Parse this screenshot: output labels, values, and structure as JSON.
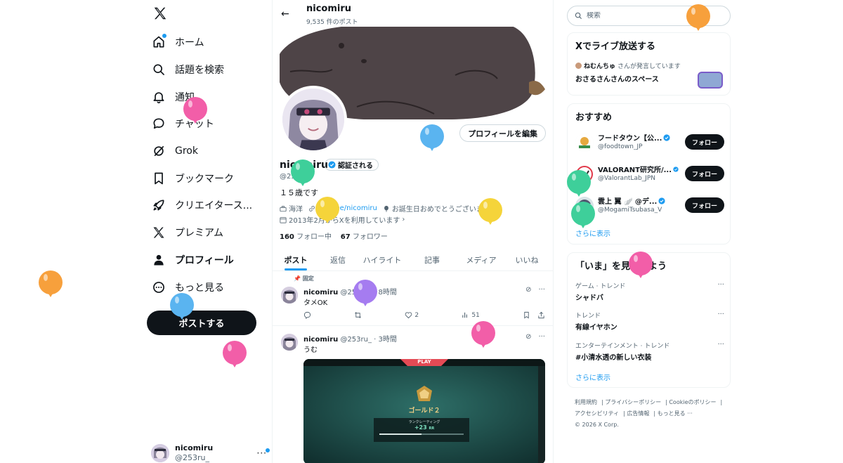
{
  "nav": {
    "home": "ホーム",
    "explore": "話題を検索",
    "notifications": "通知",
    "chat": "チャット",
    "grok": "Grok",
    "bookmarks": "ブックマーク",
    "creator": "クリエイタース...",
    "premium": "プレミアム",
    "profile": "プロフィール",
    "more": "もっと見る",
    "post_button": "ポストする"
  },
  "account": {
    "name": "nicomiru",
    "handle": "@253ru_",
    "more": "···"
  },
  "header": {
    "back": "←",
    "title": "nicomiru",
    "post_count": "9,535 件のポスト"
  },
  "profile": {
    "edit_button": "プロフィールを編集",
    "name": "nicomiru",
    "verified_label": "認証される",
    "handle": "@253ru_",
    "bio": "１５歳です",
    "location": "海洋",
    "link": "linktree/nicomiru",
    "birthday": "お誕生日おめでとうございます。",
    "joined": "2013年2月からXを利用しています",
    "following_count": "160",
    "following_label": "フォロー中",
    "followers_count": "67",
    "followers_label": "フォロワー"
  },
  "tabs": [
    "ポスト",
    "返信",
    "ハイライト",
    "記事",
    "メディア",
    "いいね"
  ],
  "tweets": [
    {
      "pinned_label": "固定",
      "name": "nicomiru",
      "meta": "@253ru_ · 8時間",
      "text": "タメOK",
      "likes": "2",
      "views": "51"
    },
    {
      "name": "nicomiru",
      "meta": "@253ru_ · 3時間",
      "text": "うむ",
      "image": {
        "play": "PLAY",
        "rank": "ゴールド２",
        "rating_label": "ランクレーティング",
        "rating_delta": "+23",
        "rating_unit": "RR"
      }
    }
  ],
  "search": {
    "placeholder": "検索"
  },
  "live": {
    "title": "Xでライブ放送する",
    "host": "ねむんちゅ",
    "host_suffix": "さんが発言しています",
    "space_title": "おさるさんさんのスペース"
  },
  "recommend": {
    "title": "おすすめ",
    "items": [
      {
        "name": "フードタウン【公...",
        "handle": "@foodtown_JP",
        "button": "フォロー"
      },
      {
        "name": "VALORANT研究所/...",
        "handle": "@ValorantLab_JPN",
        "button": "フォロー"
      },
      {
        "name": "雲上 翼 🪽 @デ...",
        "handle": "@MogamiTsubasa_V",
        "button": "フォロー"
      }
    ],
    "more": "さらに表示"
  },
  "trends": {
    "title": "「いま」を見つけよう",
    "items": [
      {
        "category": "ゲーム · トレンド",
        "topic": "シャドバ"
      },
      {
        "category": "トレンド",
        "topic": "有線イヤホン"
      },
      {
        "category": "エンターテインメント · トレンド",
        "topic": "#小清水透の新しい衣装"
      }
    ],
    "more": "さらに表示"
  },
  "footer": {
    "links": [
      "利用規約",
      "プライバシーポリシー",
      "Cookieのポリシー",
      "アクセシビリティ",
      "広告情報",
      "もっと見る ···"
    ],
    "copyright": "© 2026 X Corp."
  },
  "colors": {
    "accent": "#1d9bf0",
    "text": "#0f1419",
    "muted": "#536471",
    "border": "#eff3f4"
  },
  "balloon_colors": [
    "#f7a03c",
    "#f25ea8",
    "#5ab4f0",
    "#3ecf9a",
    "#f5d43a",
    "#a57cf0"
  ]
}
